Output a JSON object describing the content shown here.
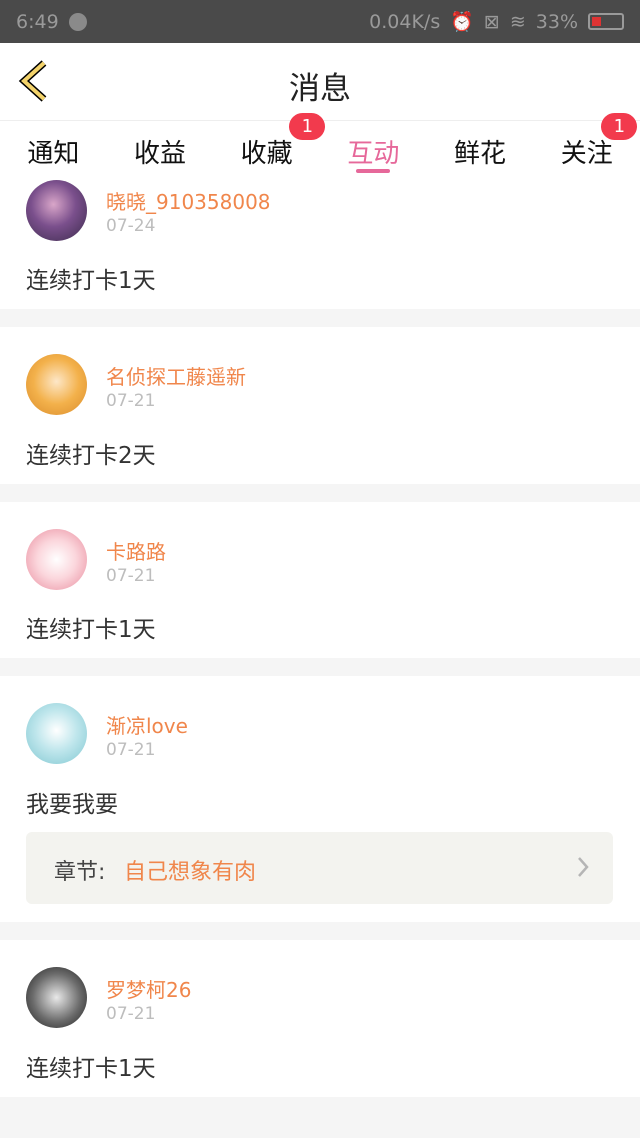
{
  "status_bar": {
    "time": "6:49",
    "network_speed": "0.04K/s",
    "battery": "33%"
  },
  "header": {
    "title": "消息"
  },
  "tabs": [
    {
      "label": "通知",
      "active": false,
      "badge": ""
    },
    {
      "label": "收益",
      "active": false,
      "badge": ""
    },
    {
      "label": "收藏",
      "active": false,
      "badge": "1"
    },
    {
      "label": "互动",
      "active": true,
      "badge": ""
    },
    {
      "label": "鲜花",
      "active": false,
      "badge": ""
    },
    {
      "label": "关注",
      "active": false,
      "badge": "1"
    }
  ],
  "messages": [
    {
      "name": "晓晓_910358008",
      "date": "07-24",
      "content": "连续打卡1天"
    },
    {
      "name": "名侦探工藤遥新",
      "date": "07-21",
      "content": "连续打卡2天"
    },
    {
      "name": "卡路路",
      "date": "07-21",
      "content": "连续打卡1天"
    },
    {
      "name": "渐凉love",
      "date": "07-21",
      "content": "我要我要",
      "chapter_label": "章节:",
      "chapter_title": "自己想象有肉"
    },
    {
      "name": "罗梦柯26",
      "date": "07-21",
      "content": "连续打卡1天"
    }
  ],
  "colors": {
    "accent_pink": "#e6689a",
    "name_orange": "#f0864b",
    "badge_red": "#f23a4d"
  }
}
